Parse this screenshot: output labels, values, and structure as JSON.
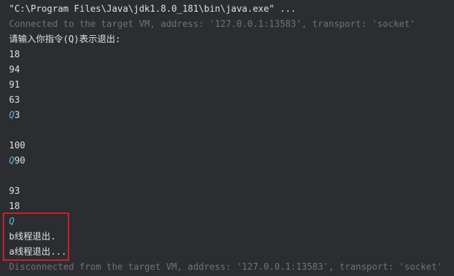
{
  "console": {
    "lines": [
      {
        "text": "\"C:\\Program Files\\Java\\jdk1.8.0_181\\bin\\java.exe\" ...",
        "kind": "command"
      },
      {
        "text": "Connected to the target VM, address: '127.0.0.1:13583', transport: 'socket'",
        "kind": "system"
      },
      {
        "text": "请输入你指令(Q)表示退出:",
        "kind": "output"
      },
      {
        "text": "18",
        "kind": "output"
      },
      {
        "text": "94",
        "kind": "output"
      },
      {
        "text": "91",
        "kind": "output"
      },
      {
        "text": "63",
        "kind": "output"
      },
      {
        "input": "Q",
        "text": "3",
        "kind": "mixed"
      },
      {
        "text": "",
        "kind": "blank"
      },
      {
        "text": "100",
        "kind": "output"
      },
      {
        "input": "Q",
        "text": "90",
        "kind": "mixed"
      },
      {
        "text": "",
        "kind": "blank"
      },
      {
        "text": "93",
        "kind": "output"
      },
      {
        "text": "18",
        "kind": "output"
      },
      {
        "input": "Q",
        "text": "",
        "kind": "mixed"
      },
      {
        "text": "b线程退出.",
        "kind": "output"
      },
      {
        "text": "a线程退出...",
        "kind": "output"
      },
      {
        "text": "Disconnected from the target VM, address: '127.0.0.1:13583', transport: 'socket'",
        "kind": "system"
      }
    ]
  },
  "colors": {
    "background": "#2b2d30",
    "text": "#dfe1e5",
    "system": "#6f737a",
    "user_input": "#5fb5d8",
    "highlight": "#d21f2a"
  }
}
